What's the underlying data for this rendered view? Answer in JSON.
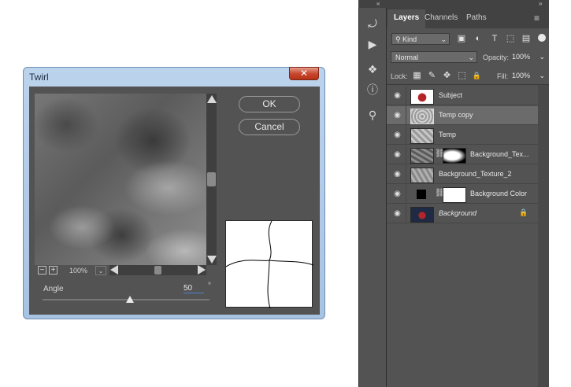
{
  "dialog": {
    "title": "Twirl",
    "close_glyph": "✕",
    "ok_label": "OK",
    "cancel_label": "Cancel",
    "zoom_out_glyph": "−",
    "zoom_in_glyph": "+",
    "zoom_level": "100%",
    "angle_label": "Angle",
    "angle_value": "50",
    "angle_unit": "°",
    "angle_slider_fraction": 0.5
  },
  "toolstrip": {
    "icons": [
      "history-brush-icon",
      "play-action-icon",
      "properties-cube-icon",
      "info-icon",
      "clone-source-icon"
    ],
    "icon_glyphs": [
      "⤾",
      "▶",
      "❖",
      "ⓘ",
      "⚲"
    ]
  },
  "layers_panel": {
    "collapse_glyph_left": "«",
    "collapse_glyph_right": "»",
    "tabs": [
      {
        "label": "Layers",
        "active": true
      },
      {
        "label": "Channels",
        "active": false
      },
      {
        "label": "Paths",
        "active": false
      }
    ],
    "menu_glyph": "≡",
    "filter_kind": "Kind",
    "filter_icons": [
      "image-filter-icon",
      "adjustment-filter-icon",
      "type-filter-icon",
      "shape-filter-icon",
      "smart-object-filter-icon"
    ],
    "filter_glyphs": [
      "▣",
      "◐",
      "T",
      "⬚",
      "▤"
    ],
    "blend_mode": "Normal",
    "opacity_label": "Opacity:",
    "opacity_value": "100%",
    "lock_label": "Lock:",
    "lock_glyphs": [
      "▦",
      "✎",
      "✥",
      "⬚",
      "🔒"
    ],
    "fill_label": "Fill:",
    "fill_value": "100%",
    "layers": [
      {
        "name": "Subject",
        "selected": false,
        "mask": false,
        "italic": false,
        "locked": false
      },
      {
        "name": "Temp copy",
        "selected": true,
        "mask": false,
        "italic": false,
        "locked": false
      },
      {
        "name": "Temp",
        "selected": false,
        "mask": false,
        "italic": false,
        "locked": false
      },
      {
        "name": "Background_Tex...",
        "selected": false,
        "mask": true,
        "italic": false,
        "locked": false
      },
      {
        "name": "Background_Texture_2",
        "selected": false,
        "mask": false,
        "italic": false,
        "locked": false
      },
      {
        "name": "Background Color",
        "selected": false,
        "mask": true,
        "italic": false,
        "locked": false
      },
      {
        "name": "Background",
        "selected": false,
        "mask": false,
        "italic": true,
        "locked": true
      }
    ],
    "eye_glyph": "👁",
    "chain_glyph": "⛓",
    "lock_icon_glyph": "🔒"
  },
  "colors": {
    "panel_bg": "#535353",
    "selected_row": "#6b6b6b",
    "dialog_chrome": "#bcd3ec",
    "close_red": "#c7422a"
  }
}
